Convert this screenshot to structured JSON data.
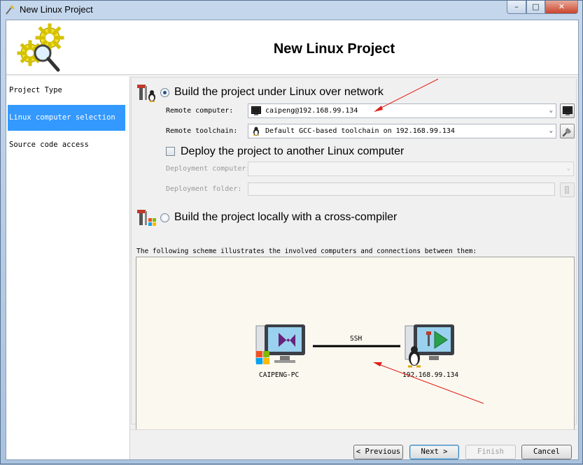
{
  "window": {
    "title": "New Linux Project",
    "min_glyph": "–",
    "max_glyph": "□",
    "close_glyph": "✕"
  },
  "header": {
    "title": "New Linux Project"
  },
  "sidebar": {
    "items": [
      {
        "label": "Project Type",
        "selected": false
      },
      {
        "label": "Linux computer selection",
        "selected": true
      },
      {
        "label": "Source code access",
        "selected": false
      }
    ]
  },
  "build_network": {
    "radio_label": "Build the project under Linux over network",
    "selected": true,
    "remote_computer_label": "Remote computer:",
    "remote_computer_value": "caipeng@192.168.99.134",
    "remote_toolchain_label": "Remote toolchain:",
    "remote_toolchain_value": "Default GCC-based toolchain on 192.168.99.134",
    "deploy_check_label": "Deploy the project to another Linux computer",
    "deploy_checked": false,
    "deployment_computer_label": "Deployment computer:",
    "deployment_folder_label": "Deployment folder:"
  },
  "build_local": {
    "radio_label": "Build the project locally with a cross-compiler",
    "selected": false
  },
  "scheme": {
    "description": "The following scheme illustrates the involved computers and connections between them:",
    "left_node": "CAIPENG-PC",
    "right_node": "192.168.99.134",
    "link_label": "SSH"
  },
  "buttons": {
    "previous": "< Previous",
    "next": "Next >",
    "finish": "Finish",
    "cancel": "Cancel"
  },
  "colors": {
    "selection": "#3399ff",
    "annotation_arrow": "#e0201b",
    "scheme_bg": "#fbf8ef"
  }
}
